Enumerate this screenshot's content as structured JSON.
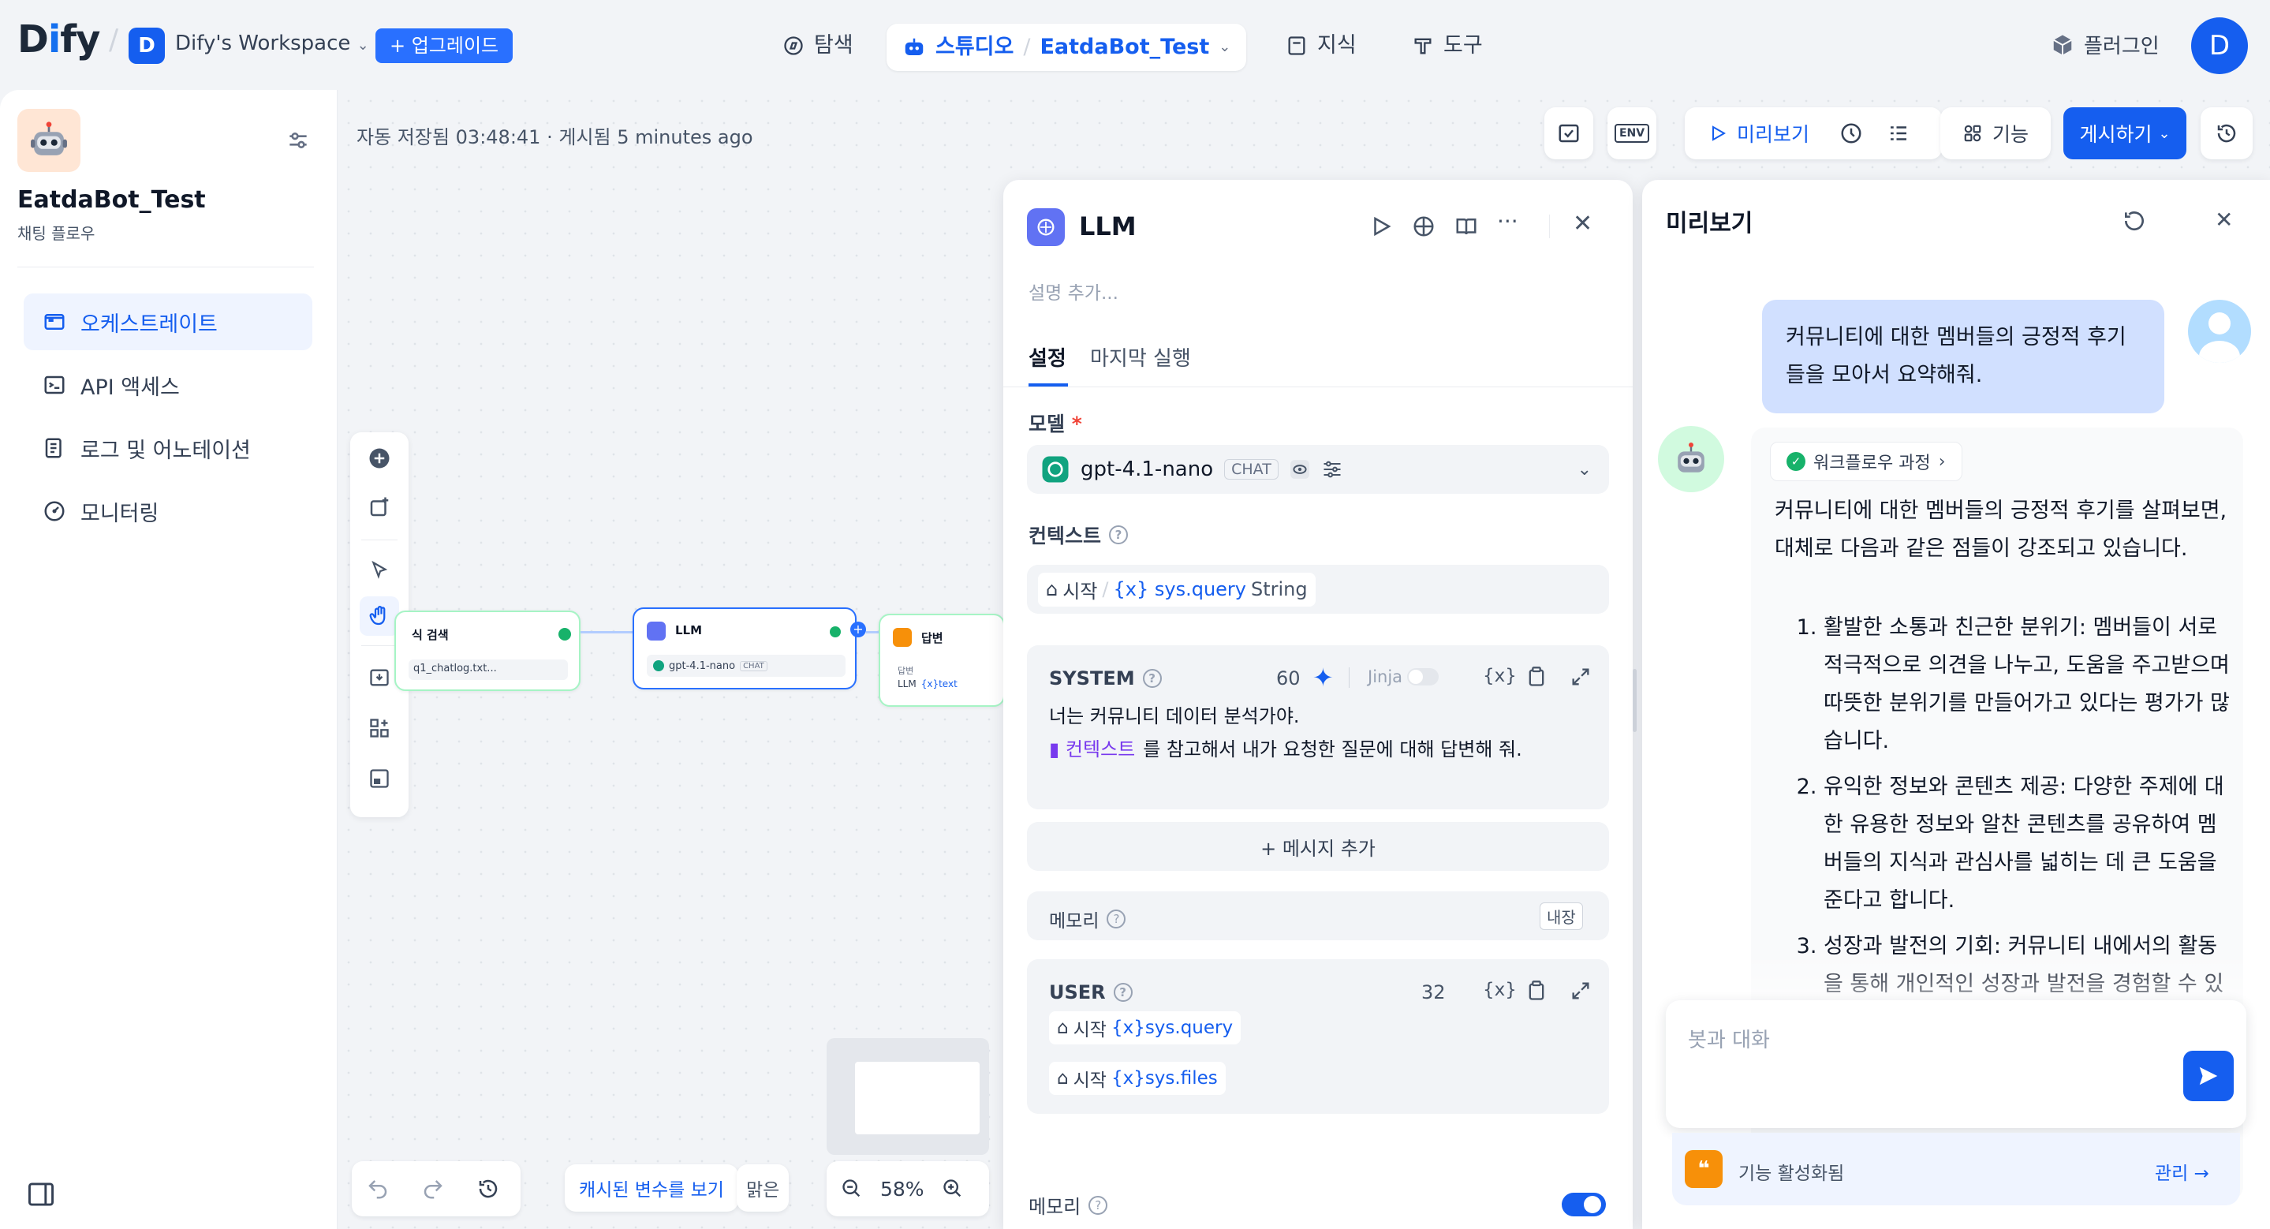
{
  "topbar": {
    "logo": "Dify",
    "workspace_initial": "D",
    "workspace_name": "Dify's Workspace",
    "upgrade": "+ 업그레이드",
    "nav_explore": "탐색",
    "nav_studio": "스튜디오",
    "app_name": "EatdaBot_Test",
    "nav_knowledge": "지식",
    "nav_tools": "도구",
    "plugins": "플러그인",
    "user_initial": "D"
  },
  "sidebar": {
    "app_name": "EatdaBot_Test",
    "app_type": "채팅 플로우",
    "items": [
      {
        "label": "오케스트레이트",
        "icon": "orchestrate-icon"
      },
      {
        "label": "API 액세스",
        "icon": "terminal-icon"
      },
      {
        "label": "로그 및 어노테이션",
        "icon": "log-icon"
      },
      {
        "label": "모니터링",
        "icon": "monitor-icon"
      }
    ]
  },
  "canvas": {
    "autosave": "자동 저장됨 03:48:41 · 게시됨 5 minutes ago",
    "node_retrieval_title": "식 검색",
    "node_retrieval_sub": "q1_chatlog.txt...",
    "node_llm_title": "LLM",
    "node_llm_model": "gpt-4.1-nano",
    "node_llm_tag": "CHAT",
    "node_answer_title": "답변",
    "node_answer_label": "답변",
    "node_answer_var": "LLM",
    "node_answer_var2": "{x}text",
    "cached_vars": "캐시된 변수를 보기",
    "clear": "맑은",
    "zoom": "58%"
  },
  "header_actions": {
    "env": "ENV",
    "preview": "미리보기",
    "features": "기능",
    "publish": "게시하기"
  },
  "llm_panel": {
    "title": "LLM",
    "description_placeholder": "설명 추가...",
    "tab_settings": "설정",
    "tab_last_run": "마지막 실행",
    "model_label": "모델",
    "required": "*",
    "model_name": "gpt-4.1-nano",
    "model_tag": "CHAT",
    "context_label": "컨텍스트",
    "context_start": "시작",
    "context_sep": "/",
    "context_var": "{x} sys.query",
    "context_type": "String",
    "system_label": "SYSTEM",
    "system_count": "60",
    "jinja": "Jinja",
    "var_btn": "{x}",
    "system_line1": "너는 커뮤니티 데이터 분석가야.",
    "system_ctx_chip": "컨텍스트",
    "system_line2": "를 참고해서 내가 요청한 질문에 대해 답변해 줘.",
    "add_message": "+ 메시지 추가",
    "memory_label": "메모리",
    "memory_badge": "내장",
    "user_label": "USER",
    "user_count": "32",
    "user_var1_start": "시작",
    "user_var1": "{x}sys.query",
    "user_var2_start": "시작",
    "user_var2": "{x}sys.files",
    "memory2_label": "메모리",
    "memory2_enabled": 1
  },
  "preview_panel": {
    "title": "미리보기",
    "user_message": "커뮤니티에 대한 멤버들의 긍정적 후기들을 모아서 요약해줘.",
    "workflow_process": "워크플로우 과정",
    "answer_intro": "커뮤니티에 대한 멤버들의 긍정적 후기를 살펴보면, 대체로 다음과 같은 점들이 강조되고 있습니다.",
    "answer_items": [
      "활발한 소통과 친근한 분위기: 멤버들이 서로 적극적으로 의견을 나누고, 도움을 주고받으며 따뜻한 분위기를 만들어가고 있다는 평가가 많습니다.",
      "유익한 정보와 콘텐츠 제공: 다양한 주제에 대한 유용한 정보와 알찬 콘텐츠를 공유하여 멤버들의 지식과 관심사를 넓히는 데 큰 도움을 준다고 합니다.",
      "성장과 발전의 기회: 커뮤니티 내에서의 활동을 통해 개인적인 성장과 발전을 경험할 수 있으며, 새로운 아이디어와 영감을 얻는 공간으로 자리 잡고 있다는 후기가 많습니다."
    ],
    "input_placeholder": "봇과 대화",
    "features_enabled": "기능 활성화됨",
    "manage": "관리 →"
  },
  "colors": {
    "accent": "#155eef",
    "llm_node": "#6172f3",
    "answer_node": "#f79009",
    "success": "#17b26a"
  }
}
